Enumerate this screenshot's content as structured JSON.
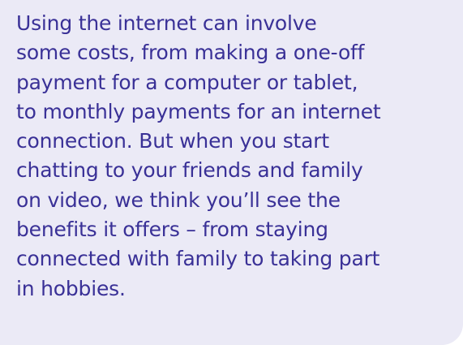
{
  "card": {
    "background_color": "#ebeaf6",
    "text_color": "#3a3197",
    "lines": [
      "Using the internet can involve",
      "some costs, from making a one-off",
      "payment for a computer or tablet,",
      "to monthly payments for an internet",
      "connection. But when you start",
      "chatting to your friends and family",
      "on video, we think you’ll see the",
      "benefits it offers – from staying",
      "connected with family to taking part",
      "in hobbies."
    ]
  }
}
